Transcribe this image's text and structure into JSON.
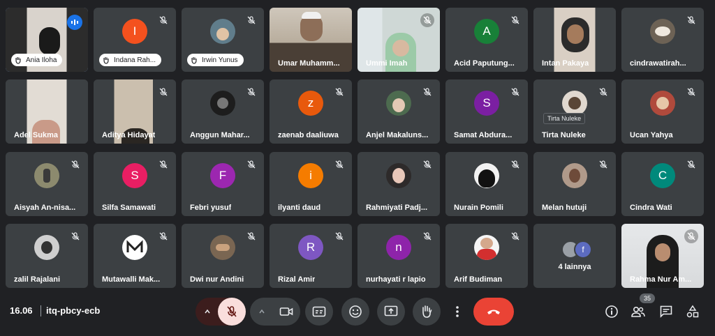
{
  "tiles": [
    {
      "name": "Ania Iloha",
      "kind": "pill"
    },
    {
      "name": "Indana Rah...",
      "kind": "pill"
    },
    {
      "name": "Irwin Yunus",
      "kind": "pill"
    },
    {
      "name": "Umar Muhamm...",
      "kind": "name"
    },
    {
      "name": "Ummi Imah",
      "kind": "name"
    },
    {
      "name": "Acid Paputung...",
      "kind": "name",
      "letter": "A"
    },
    {
      "name": "Intan Pakaya",
      "kind": "name"
    },
    {
      "name": "cindrawatirah...",
      "kind": "name"
    },
    {
      "name": "Adel Sukma",
      "kind": "name"
    },
    {
      "name": "Aditya Hidayat",
      "kind": "name"
    },
    {
      "name": "Anggun Mahar...",
      "kind": "name"
    },
    {
      "name": "zaenab daaliuwa",
      "kind": "name",
      "letter": "z"
    },
    {
      "name": "Anjel Makaluns...",
      "kind": "name"
    },
    {
      "name": "Samat Abdura...",
      "kind": "name",
      "letter": "S"
    },
    {
      "name": "Tirta Nuleke",
      "kind": "name",
      "tooltip": "Tirta Nuleke"
    },
    {
      "name": "Ucan Yahya",
      "kind": "name"
    },
    {
      "name": "Aisyah An-nisa...",
      "kind": "name"
    },
    {
      "name": "Silfa Samawati",
      "kind": "name",
      "letter": "S"
    },
    {
      "name": "Febri yusuf",
      "kind": "name",
      "letter": "F"
    },
    {
      "name": "ilyanti daud",
      "kind": "name",
      "letter": "i"
    },
    {
      "name": "Rahmiyati Padj...",
      "kind": "name"
    },
    {
      "name": "Nurain Pomili",
      "kind": "name"
    },
    {
      "name": "Melan hutuji",
      "kind": "name"
    },
    {
      "name": "Cindra Wati",
      "kind": "name",
      "letter": "C"
    },
    {
      "name": "zalil Rajalani",
      "kind": "name"
    },
    {
      "name": "Mutawalli Mak...",
      "kind": "name"
    },
    {
      "name": "Dwi nur Andini",
      "kind": "name"
    },
    {
      "name": "Rizal Amir",
      "kind": "name",
      "letter": "R"
    },
    {
      "name": "nurhayati r lapio",
      "kind": "name",
      "letter": "n"
    },
    {
      "name": "Arif Budiman",
      "kind": "name"
    },
    {
      "name": "4 lainnya",
      "kind": "more",
      "letter": "f"
    },
    {
      "name": "Rahma Nur Am...",
      "kind": "name"
    }
  ],
  "colors": {
    "A": "#188038",
    "z": "#e8590c",
    "S_purple": "#7b1fa2",
    "S_pink": "#e91e63",
    "F": "#9c27b0",
    "i": "#f57c00",
    "C": "#00897b",
    "R": "#7e57c2",
    "n": "#8e24aa",
    "f": "#5c6bc0"
  },
  "bottom": {
    "time": "16.06",
    "meeting_code": "itq-pbcy-ecb",
    "participant_count": "35"
  }
}
